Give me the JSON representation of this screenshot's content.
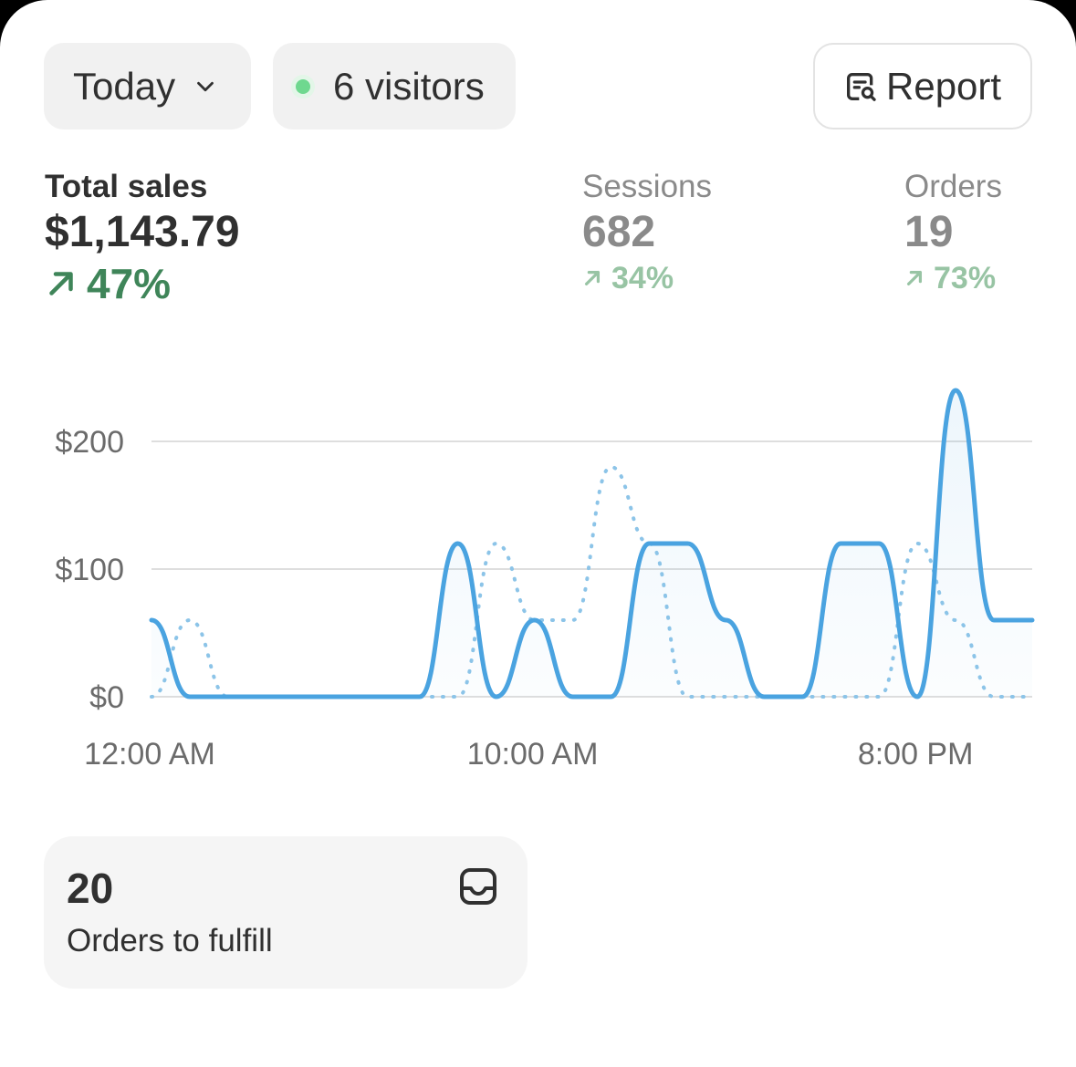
{
  "toolbar": {
    "date_label": "Today",
    "visitors_label": "6 visitors",
    "report_label": "Report"
  },
  "metrics": {
    "total_sales": {
      "label": "Total sales",
      "value": "$1,143.79",
      "delta": "47%"
    },
    "sessions": {
      "label": "Sessions",
      "value": "682",
      "delta": "34%"
    },
    "orders": {
      "label": "Orders",
      "value": "19",
      "delta": "73%"
    }
  },
  "chart_data": {
    "type": "line",
    "x_tick_labels": [
      "12:00 AM",
      "10:00 AM",
      "8:00 PM"
    ],
    "y_tick_labels": [
      "$0",
      "$100",
      "$200"
    ],
    "ylim": [
      0,
      200
    ],
    "grid": true,
    "series": [
      {
        "style": "solid",
        "color": "#4aa3e0",
        "points": [
          [
            0,
            60
          ],
          [
            1,
            0
          ],
          [
            2,
            0
          ],
          [
            3,
            0
          ],
          [
            4,
            0
          ],
          [
            5,
            0
          ],
          [
            6,
            0
          ],
          [
            7,
            0
          ],
          [
            8,
            120
          ],
          [
            9,
            0
          ],
          [
            10,
            60
          ],
          [
            11,
            0
          ],
          [
            12,
            0
          ],
          [
            13,
            120
          ],
          [
            14,
            120
          ],
          [
            15,
            60
          ],
          [
            16,
            0
          ],
          [
            17,
            0
          ],
          [
            18,
            120
          ],
          [
            19,
            120
          ],
          [
            20,
            0
          ],
          [
            21,
            240
          ],
          [
            22,
            60
          ],
          [
            23,
            60
          ]
        ]
      },
      {
        "style": "dotted",
        "color": "#8cc4e8",
        "points": [
          [
            0,
            0
          ],
          [
            1,
            60
          ],
          [
            2,
            0
          ],
          [
            3,
            0
          ],
          [
            4,
            0
          ],
          [
            5,
            0
          ],
          [
            6,
            0
          ],
          [
            7,
            0
          ],
          [
            8,
            0
          ],
          [
            9,
            120
          ],
          [
            10,
            60
          ],
          [
            11,
            60
          ],
          [
            12,
            180
          ],
          [
            13,
            120
          ],
          [
            14,
            0
          ],
          [
            15,
            0
          ],
          [
            16,
            0
          ],
          [
            17,
            0
          ],
          [
            18,
            0
          ],
          [
            19,
            0
          ],
          [
            20,
            120
          ],
          [
            21,
            60
          ],
          [
            22,
            0
          ],
          [
            23,
            0
          ]
        ]
      }
    ]
  },
  "fulfill_card": {
    "count": "20",
    "label": "Orders to fulfill"
  },
  "colors": {
    "accent_blue": "#4aa3e0",
    "positive_green": "#3f8559",
    "live_dot": "#6fd88f"
  },
  "icons": {
    "date_dropdown": "chevron-down-icon",
    "report": "report-search-icon",
    "fulfill": "inbox-icon",
    "delta": "arrow-up-right-icon"
  }
}
